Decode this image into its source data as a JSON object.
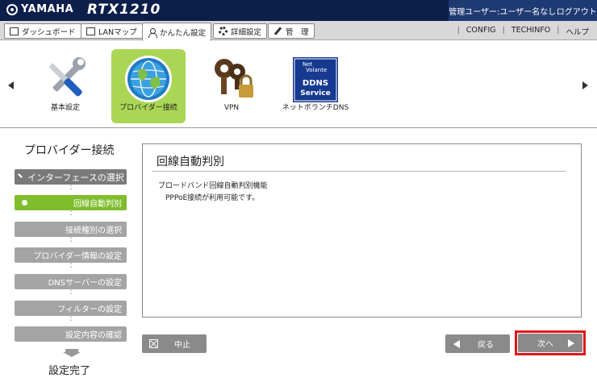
{
  "header": {
    "brand": "YAMAHA",
    "model": "RTX1210",
    "user_label": "管理ユーザー:ユーザー名なし",
    "logout": "ログアウト"
  },
  "nav": {
    "tabs": [
      {
        "label": "ダッシュボード",
        "icon": "dashboard-icon"
      },
      {
        "label": "LANマップ",
        "icon": "lan-map-icon"
      },
      {
        "label": "かんたん設定",
        "icon": "easy-setup-icon",
        "active": true
      },
      {
        "label": "詳細設定",
        "icon": "gear-icon"
      },
      {
        "label": "管　理",
        "icon": "tools-icon"
      }
    ],
    "links": [
      "CONFIG",
      "TECHINFO",
      "ヘルプ"
    ]
  },
  "carousel": {
    "items": [
      {
        "label": "基本設定",
        "icon": "wrench-screwdriver-icon"
      },
      {
        "label": "プロバイダー接続",
        "icon": "globe-icon",
        "selected": true
      },
      {
        "label": "VPN",
        "icon": "keys-lock-icon"
      },
      {
        "label": "ネットボランチDNS",
        "icon": "ddns-service-icon",
        "logo_text": [
          "Net",
          "Volante",
          "DDNS",
          "Service"
        ]
      }
    ]
  },
  "wizard": {
    "title": "プロバイダー接続",
    "steps": [
      {
        "label": "インターフェースの選択",
        "state": "done"
      },
      {
        "label": "回線自動判別",
        "state": "current"
      },
      {
        "label": "接続種別の選択",
        "state": "pending"
      },
      {
        "label": "プロバイダー情報の設定",
        "state": "pending"
      },
      {
        "label": "DNSサーバーの設定",
        "state": "pending"
      },
      {
        "label": "フィルターの設定",
        "state": "pending"
      },
      {
        "label": "設定内容の確認",
        "state": "pending"
      }
    ],
    "complete": "設定完了"
  },
  "main": {
    "title": "回線自動判別",
    "detection_label": "ブロードバンド回線自動判別機能",
    "detection_result": "PPPoE接続が利用可能です。"
  },
  "buttons": {
    "cancel": "中止",
    "back": "戻る",
    "next": "次へ"
  },
  "colors": {
    "header_bg": "#0c1e4a",
    "selected_green": "#aad655",
    "current_step_green": "#7fbd2c",
    "highlight_red": "#e0161c"
  }
}
